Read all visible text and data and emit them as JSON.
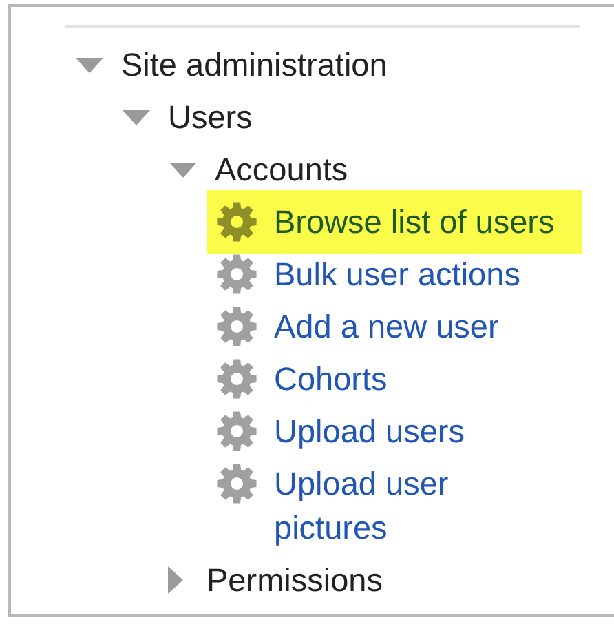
{
  "tree": [
    {
      "label": "Site administration",
      "kind": "folder",
      "expanded": true,
      "children": [
        {
          "label": "Users",
          "kind": "folder",
          "expanded": true,
          "children": [
            {
              "label": "Accounts",
              "kind": "folder",
              "expanded": true,
              "children": [
                {
                  "label": "Browse list of users",
                  "kind": "link",
                  "selected": true
                },
                {
                  "label": "Bulk user actions",
                  "kind": "link",
                  "selected": false
                },
                {
                  "label": "Add a new user",
                  "kind": "link",
                  "selected": false
                },
                {
                  "label": "Cohorts",
                  "kind": "link",
                  "selected": false
                },
                {
                  "label": "Upload users",
                  "kind": "link",
                  "selected": false
                },
                {
                  "label": "Upload user pictures",
                  "kind": "link",
                  "selected": false
                }
              ]
            },
            {
              "label": "Permissions",
              "kind": "folder",
              "expanded": false
            }
          ]
        }
      ]
    }
  ]
}
